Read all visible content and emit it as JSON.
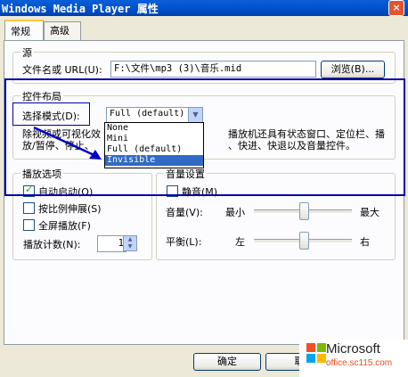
{
  "window": {
    "title": "Windows Media Player 属性",
    "close_glyph": "×"
  },
  "tabs": [
    {
      "label": "常规"
    },
    {
      "label": "高级"
    }
  ],
  "source": {
    "group_label": "源",
    "file_label": "文件名或 URL(U):",
    "file_value": "F:\\文件\\mp3 (3)\\音乐.mid",
    "browse_button": "浏览(B)..."
  },
  "layout": {
    "group_label": "控件布局",
    "mode_label": "选择模式(D):",
    "mode_value": "Full (default)",
    "options": [
      "None",
      "Mini",
      "Full (default)",
      "Invisible"
    ],
    "selected_option": "Invisible",
    "description_line1": "除视频或可视化效",
    "description_line1b": "播放机还具有状态窗口、定位栏、播",
    "description_line2": "放/暂停、停止、",
    "description_line2b": "、快进、快退以及音量控件。"
  },
  "playback": {
    "group_label": "播放选项",
    "autostart_label": "自动启动(O)",
    "autostart_checked": true,
    "stretch_label": "按比例伸展(S)",
    "stretch_checked": false,
    "fullscreen_label": "全屏播放(F)",
    "fullscreen_checked": false,
    "count_label": "播放计数(N):",
    "count_value": "1"
  },
  "audio": {
    "group_label": "音量设置",
    "mute_label": "静音(M)",
    "mute_checked": false,
    "volume_label": "音量(V):",
    "volume_min": "最小",
    "volume_max": "最大",
    "volume_level": 0.5,
    "balance_label": "平衡(L):",
    "balance_left": "左",
    "balance_right": "右",
    "balance_level": 0.5
  },
  "footer": {
    "ok_button": "确定",
    "cancel_button": "取"
  },
  "watermark": {
    "brand": "Microsoft",
    "url": "office.sc115.com"
  },
  "colors": {
    "highlight": "#0000aa",
    "selection": "#316ac5",
    "title_bar": "#0050c8"
  }
}
